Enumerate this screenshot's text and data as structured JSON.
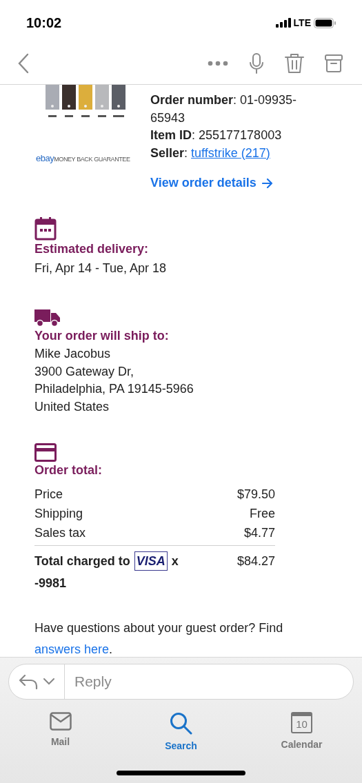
{
  "status_bar": {
    "time": "10:02",
    "network": "LTE"
  },
  "order_info": {
    "brand": {
      "logo": "ebay",
      "text": "MONEY BACK GUARANTEE"
    },
    "fields": [
      {
        "label": "Order number",
        "separator": ":",
        "value": "01-09935-65943",
        "kind": "text"
      },
      {
        "label": "Item ID",
        "separator": ":",
        "value": "255177178003",
        "kind": "text"
      },
      {
        "label": "Seller",
        "separator": ":",
        "value": "tuffstrike (217)",
        "kind": "link"
      }
    ],
    "view_link": "View order details"
  },
  "delivery": {
    "heading": "Estimated delivery:",
    "dates": "Fri, Apr 14 - Tue, Apr 18"
  },
  "shipping": {
    "heading": "Your order will ship to:",
    "address": [
      "Mike Jacobus",
      "3900 Gateway Dr,",
      "Philadelphia, PA 19145-5966",
      "United States"
    ]
  },
  "order_total": {
    "heading": "Order total:",
    "rows": [
      {
        "label": "Price",
        "amount": "$79.50"
      },
      {
        "label": "Shipping",
        "amount": "Free"
      },
      {
        "label": "Sales tax",
        "amount": "$4.77"
      }
    ],
    "total": {
      "prefix": "Total charged to",
      "card_brand": "VISA",
      "card_suffix": "x",
      "card_number": "-9981",
      "amount": "$84.27"
    }
  },
  "questions": {
    "text": "Have questions about your guest order? Find",
    "link": "answers here",
    "end": "."
  },
  "reply_field": {
    "placeholder": "Reply"
  },
  "tabs": [
    {
      "label": "Mail",
      "selected": false,
      "kind": "mail"
    },
    {
      "label": "Search",
      "selected": true,
      "kind": "search"
    },
    {
      "label": "Calendar",
      "selected": false,
      "kind": "calendar",
      "day": "10"
    }
  ]
}
